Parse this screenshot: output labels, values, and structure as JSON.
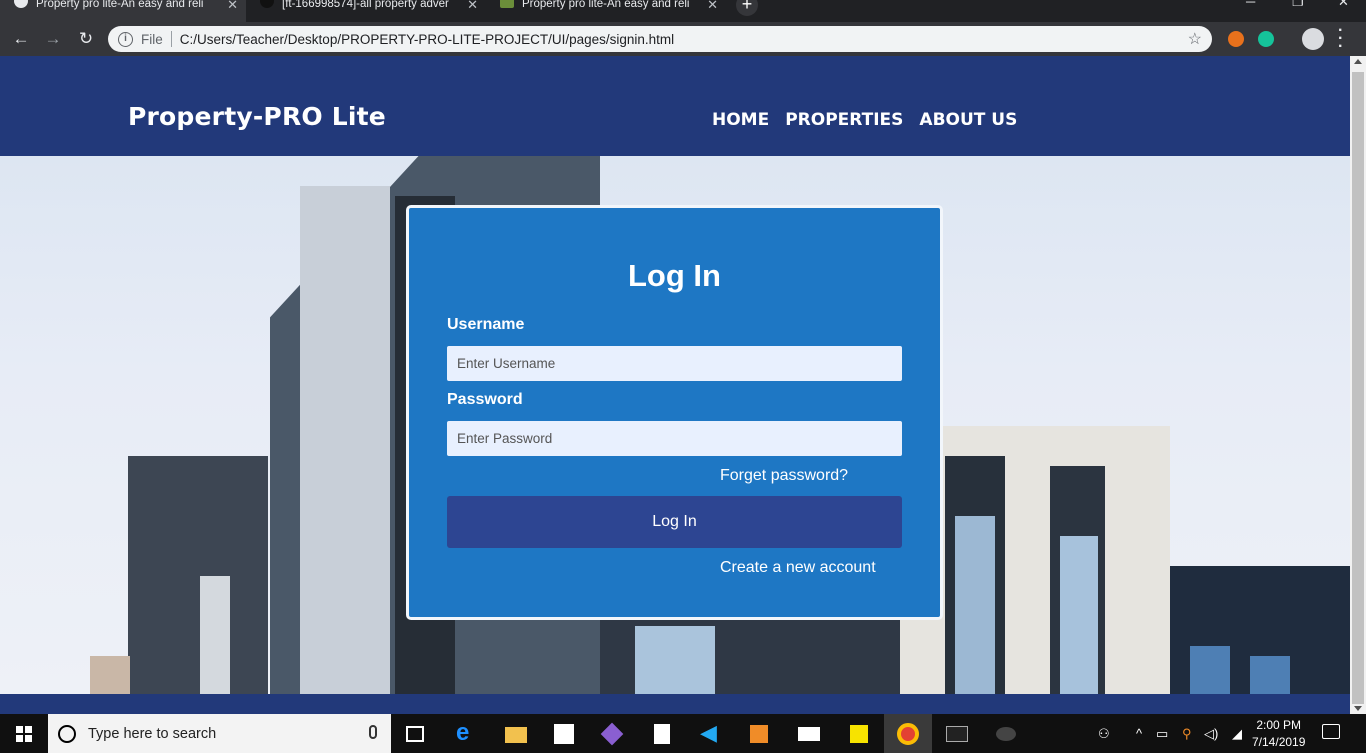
{
  "browser": {
    "tabs": [
      {
        "title": "Property pro lite-An easy and reli",
        "active": true
      },
      {
        "title": "[ft-166998574]-all property adver",
        "active": false
      },
      {
        "title": "Property pro lite-An easy and reli",
        "active": false
      }
    ],
    "new_tab_label": "+",
    "omnibox": {
      "scheme_label": "File",
      "url": "C:/Users/Teacher/Desktop/PROPERTY-PRO-LITE-PROJECT/UI/pages/signin.html"
    }
  },
  "site": {
    "brand": "Property-PRO Lite",
    "nav": [
      "HOME",
      "PROPERTIES",
      "ABOUT US"
    ]
  },
  "login": {
    "title": "Log In",
    "username_label": "Username",
    "username_placeholder": "Enter Username",
    "password_label": "Password",
    "password_placeholder": "Enter Password",
    "forgot_link": "Forget password?",
    "submit_label": "Log In",
    "create_link": "Create a new account"
  },
  "taskbar": {
    "search_placeholder": "Type here to search",
    "time": "2:00 PM",
    "date": "7/14/2019"
  },
  "colors": {
    "header": "#22397a",
    "card": "#1e77c4",
    "button": "#2d4592"
  }
}
